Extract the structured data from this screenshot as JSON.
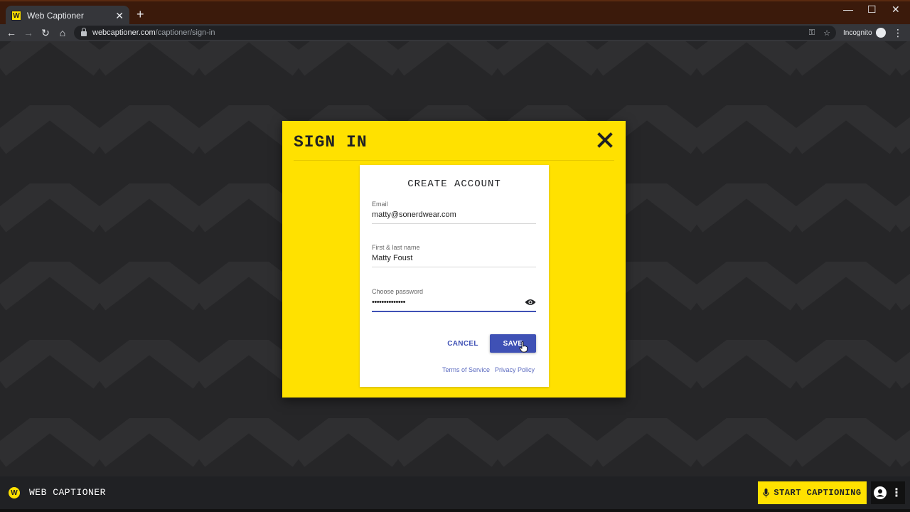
{
  "browser": {
    "tab_title": "Web Captioner",
    "tab_favicon_letter": "W",
    "new_tab_symbol": "+",
    "url_host": "webcaptioner.com",
    "url_path": "/captioner/sign-in",
    "incognito_label": "Incognito",
    "window_controls": [
      "minimize-icon",
      "maximize-icon",
      "close-icon"
    ]
  },
  "modal": {
    "title": "SIGN IN",
    "card_title": "CREATE ACCOUNT",
    "fields": {
      "email": {
        "label": "Email",
        "value": "matty@sonerdwear.com"
      },
      "name": {
        "label": "First & last name",
        "value": "Matty Foust"
      },
      "password": {
        "label": "Choose password",
        "value": "••••••••••••••"
      }
    },
    "cancel_label": "CANCEL",
    "save_label": "SAVE",
    "terms_label": "Terms of Service",
    "privacy_label": "Privacy Policy"
  },
  "bottombar": {
    "logo_letter": "W",
    "brand": "WEB CAPTIONER",
    "start_label": "START CAPTIONING"
  },
  "colors": {
    "accent_yellow": "#ffe100",
    "primary_blue": "#3f51b5",
    "page_dark": "#262628"
  }
}
